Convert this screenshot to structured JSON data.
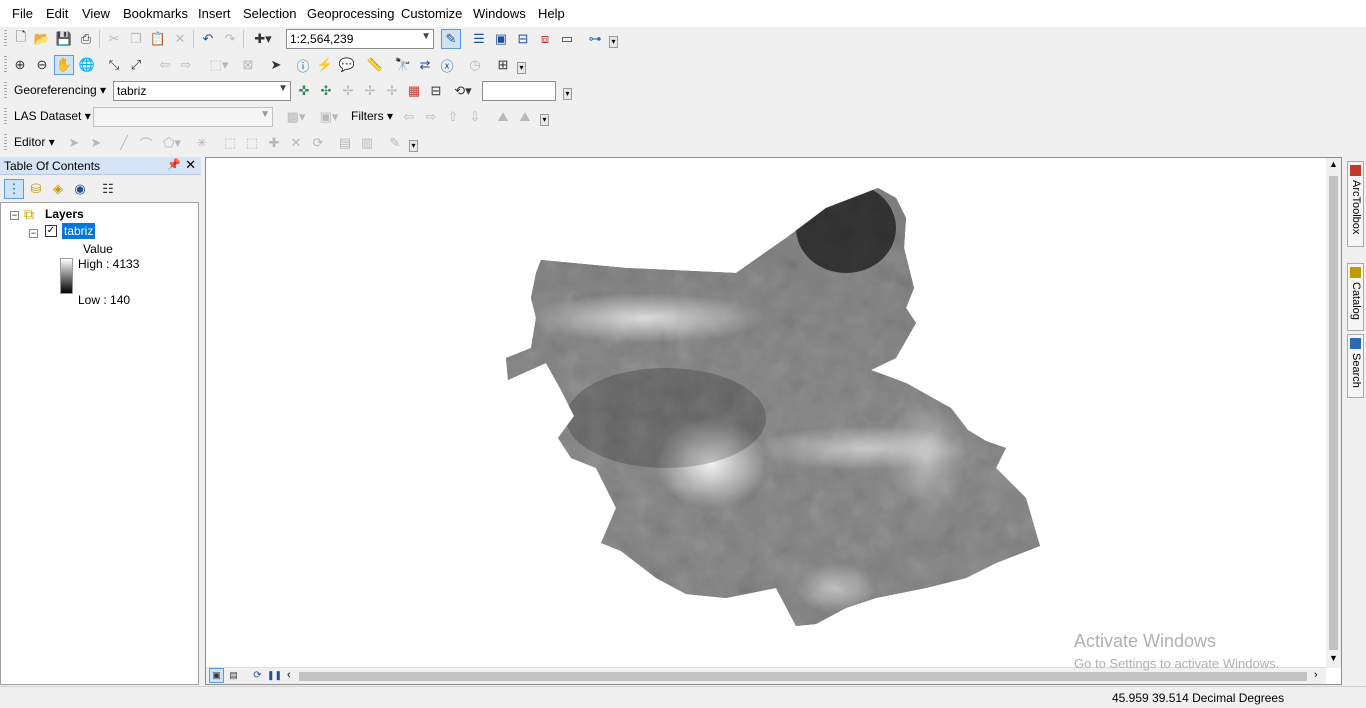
{
  "menu": [
    "File",
    "Edit",
    "View",
    "Bookmarks",
    "Insert",
    "Selection",
    "Geoprocessing",
    "Customize",
    "Windows",
    "Help"
  ],
  "standard_toolbar": {
    "scale": "1:2,564,239"
  },
  "georef_toolbar": {
    "label": "Georeferencing",
    "layer": "tabriz"
  },
  "las_toolbar": {
    "label": "LAS Dataset",
    "filters": "Filters"
  },
  "editor_toolbar": {
    "label": "Editor"
  },
  "toc": {
    "title": "Table Of Contents",
    "root": "Layers",
    "layer": "tabriz",
    "legend_field": "Value",
    "high": "High : 4133",
    "low": "Low : 140"
  },
  "watermark": {
    "line1": "Activate Windows",
    "line2": "Go to Settings to activate Windows."
  },
  "side_tabs": [
    "ArcToolbox",
    "Catalog",
    "Search"
  ],
  "status": {
    "coords": "45.959  39.514 Decimal Degrees"
  }
}
